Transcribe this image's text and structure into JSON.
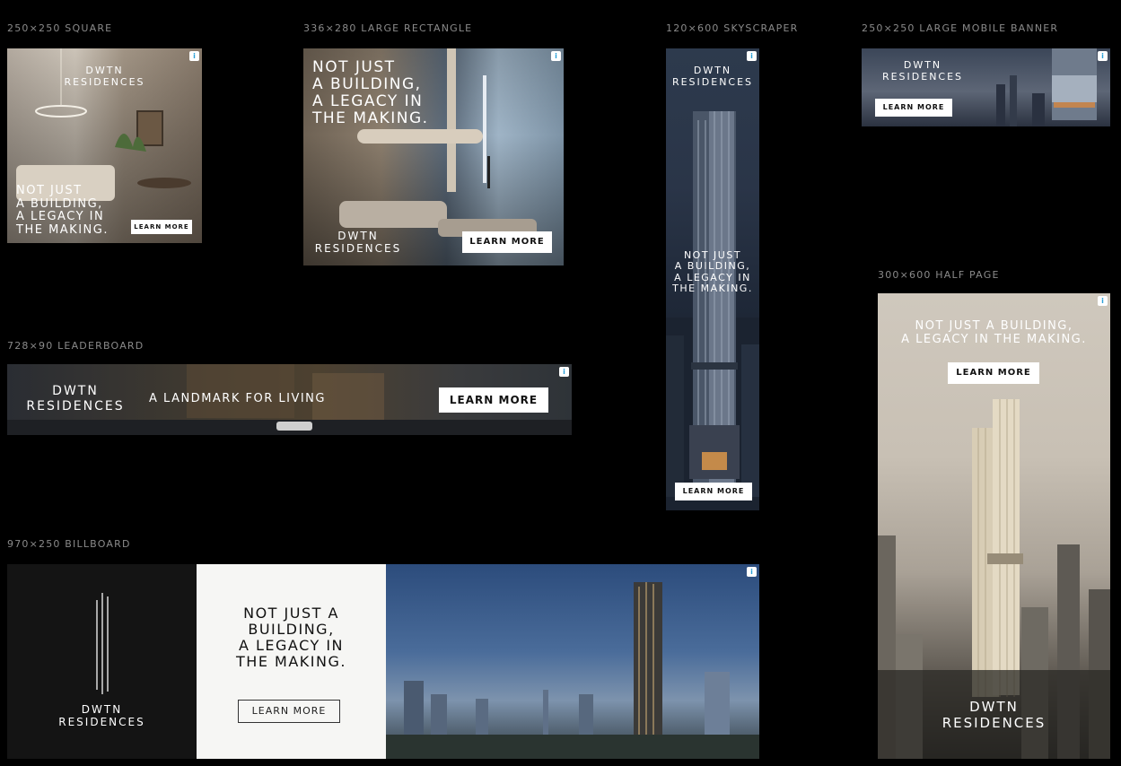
{
  "labels": {
    "square": "250×250 SQUARE",
    "large_rect": "336×280 LARGE RECTANGLE",
    "skyscraper": "120×600 SKYSCRAPER",
    "mobile_banner": "250×250 LARGE MOBILE BANNER",
    "half_page": "300×600 HALF PAGE",
    "leaderboard": "728×90 LEADERBOARD",
    "billboard": "970×250 BILLBOARD"
  },
  "brand": {
    "line1": "DWTN",
    "line2": "RESIDENCES"
  },
  "headline": {
    "l1": "NOT JUST",
    "l2": "A BUILDING,",
    "l3": "A LEGACY IN",
    "l4": "THE MAKING."
  },
  "half_page_headline": {
    "l1": "NOT JUST A BUILDING,",
    "l2": "A LEGACY IN THE MAKING."
  },
  "billboard_headline": {
    "l1": "NOT JUST A",
    "l2": "BUILDING,",
    "l3": "A LEGACY IN",
    "l4": "THE MAKING."
  },
  "leaderboard_tagline": "A LANDMARK FOR LIVING",
  "cta": "LEARN MORE",
  "adchoices_icon": "info-icon",
  "colors": {
    "background": "#000000",
    "label": "#8a8a8a",
    "button": "#ffffff"
  }
}
